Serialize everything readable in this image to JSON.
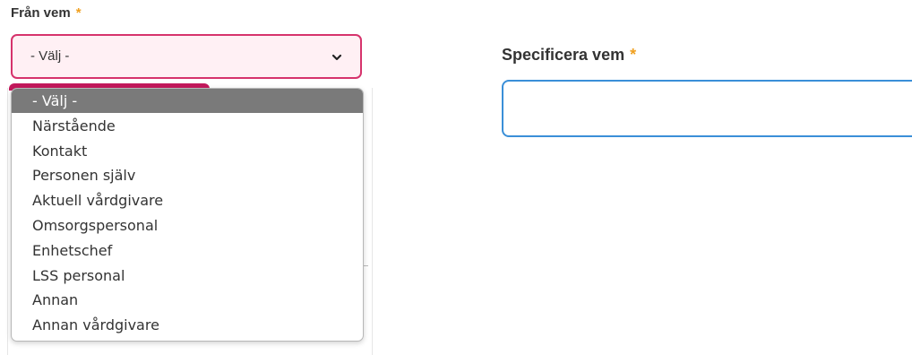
{
  "from_field": {
    "label": "Från vem",
    "required_marker": "*",
    "selected_value": "- Välj -",
    "options": [
      "- Välj -",
      "Närstående",
      "Kontakt",
      "Personen själv",
      "Aktuell vårdgivare",
      "Omsorgspersonal",
      "Enhetschef",
      "LSS personal",
      "Annan",
      "Annan vårdgivare"
    ],
    "highlighted_option_index": 0
  },
  "specify_field": {
    "label": "Specificera vem",
    "required_marker": "*",
    "value": ""
  },
  "colors": {
    "required": "#f0a020",
    "select_border": "#d6336c",
    "select_bg": "#fff0f4",
    "highlight_bg": "#7a7a7a",
    "input_border": "#3a8fd8"
  },
  "icons": {
    "select_chevron": "chevron-down-icon"
  }
}
